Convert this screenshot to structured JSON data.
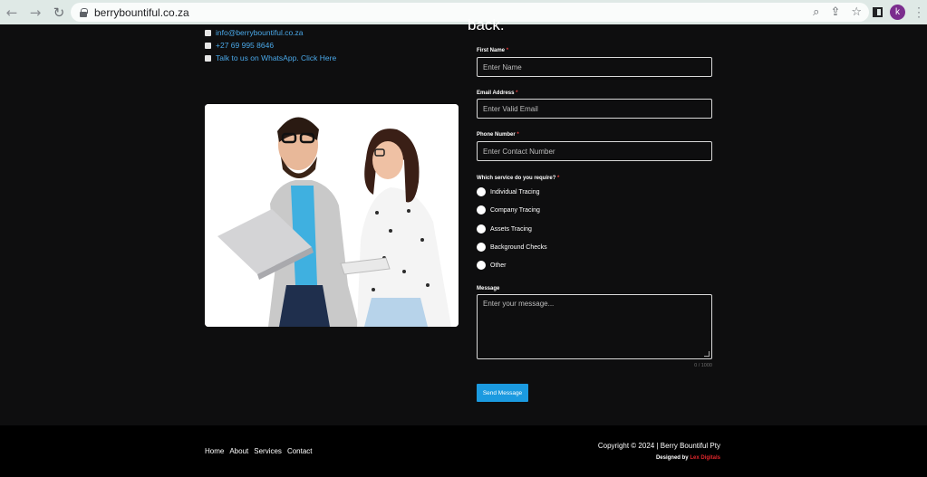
{
  "browser": {
    "url": "berrybountiful.co.za",
    "profile_initial": "k"
  },
  "contact": {
    "email": "info@berrybountiful.co.za",
    "phone": "+27 69 995 8646",
    "whatsapp": "Talk to us on WhatsApp. Click Here"
  },
  "heading_tail": "back.",
  "form": {
    "first_name": {
      "label": "First Name",
      "required": "*",
      "placeholder": "Enter Name"
    },
    "email": {
      "label": "Email Address",
      "required": "*",
      "placeholder": "Enter Valid Email"
    },
    "phone": {
      "label": "Phone Number",
      "required": "*",
      "placeholder": "Enter Contact Number"
    },
    "service": {
      "label": "Which service do you require?",
      "required": "*",
      "options": [
        "Individual Tracing",
        "Company Tracing",
        "Assets Tracing",
        "Background Checks",
        "Other"
      ]
    },
    "message": {
      "label": "Message",
      "placeholder": "Enter your message...",
      "counter": "0 / 1000"
    },
    "submit_label": "Send Message"
  },
  "footer": {
    "nav": [
      "Home",
      "About",
      "Services",
      "Contact"
    ],
    "copyright": "Copyright © 2024 | Berry Bountiful Pty",
    "designed_by": "Designed by",
    "designer": "Lex Digitals"
  },
  "colors": {
    "link": "#4aa8e8",
    "button": "#1b9ae0",
    "required": "#e23b3b",
    "designer": "#e0262b"
  }
}
